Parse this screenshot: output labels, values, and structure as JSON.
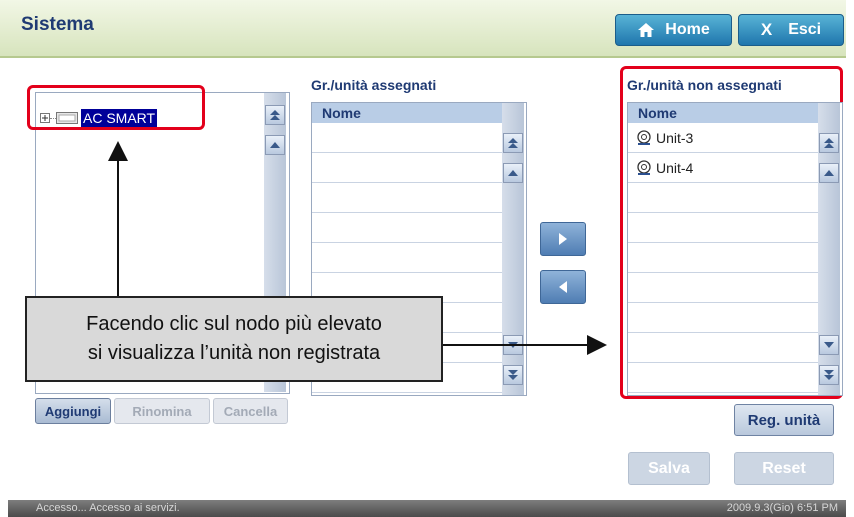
{
  "header": {
    "title": "Sistema",
    "home_label": "Home",
    "exit_label": "Esci"
  },
  "tree": {
    "root_label": "AC SMART"
  },
  "assigned": {
    "title": "Gr./unità assegnati",
    "column": "Nome",
    "rows": []
  },
  "unassigned": {
    "title": "Gr./unità non assegnati",
    "column": "Nome",
    "rows": [
      "Unit-3",
      "Unit-4"
    ]
  },
  "buttons": {
    "add": "Aggiungi",
    "rename": "Rinomina",
    "delete": "Cancella",
    "reg_unit": "Reg. unità",
    "save": "Salva",
    "reset": "Reset"
  },
  "callout": {
    "line1": "Facendo clic sul nodo più elevato",
    "line2": "si visualizza l’unità non registrata"
  },
  "status": {
    "left": "Accesso... Accesso ai servizi.",
    "right": "2009.9.3(Gio)  6:51 PM"
  },
  "colors": {
    "accent": "#1f3a73",
    "highlight": "#e3001b",
    "selection": "#000099"
  }
}
